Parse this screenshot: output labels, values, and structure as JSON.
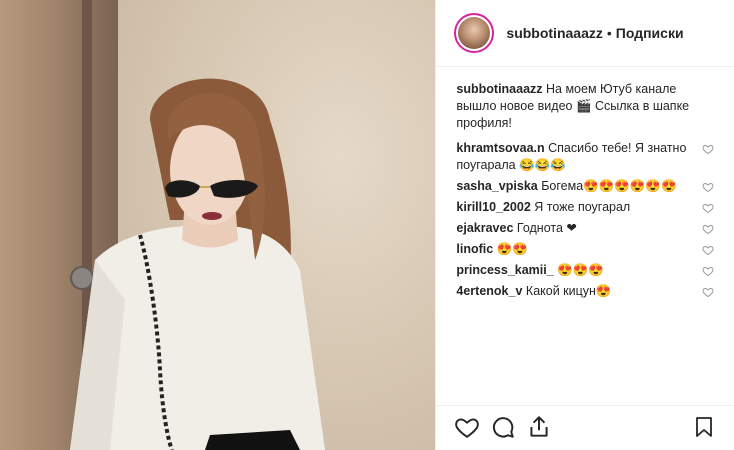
{
  "header": {
    "username": "subbotinaaazz",
    "separator": "•",
    "follow_label": "Подписки"
  },
  "caption": {
    "username": "subbotinaaazz",
    "text": "На моем Ютуб канале вышло новое видео 🎬 Ссылка в шапке профиля!"
  },
  "comments": [
    {
      "username": "khramtsovaa.n",
      "text": "Спасибо тебе! Я знатно поугарала 😂😂😂"
    },
    {
      "username": "sasha_vpiska",
      "text": "Богема😍😍😍😍😍😍"
    },
    {
      "username": "kirill10_2002",
      "text": "Я тоже поугарал"
    },
    {
      "username": "ejakravec",
      "text": "Годнота ❤"
    },
    {
      "username": "linofic",
      "text": "😍😍"
    },
    {
      "username": "princess_kamii_",
      "text": "😍😍😍"
    },
    {
      "username": "4ertenok_v",
      "text": "Какой кицун😍"
    }
  ],
  "icons": {
    "like": "heart-icon",
    "comment": "comment-icon",
    "share": "share-icon",
    "save": "bookmark-icon",
    "comment_like": "heart-icon"
  },
  "colors": {
    "text": "#262626",
    "border": "#efefef",
    "avatar_ring": "#d6249f"
  }
}
